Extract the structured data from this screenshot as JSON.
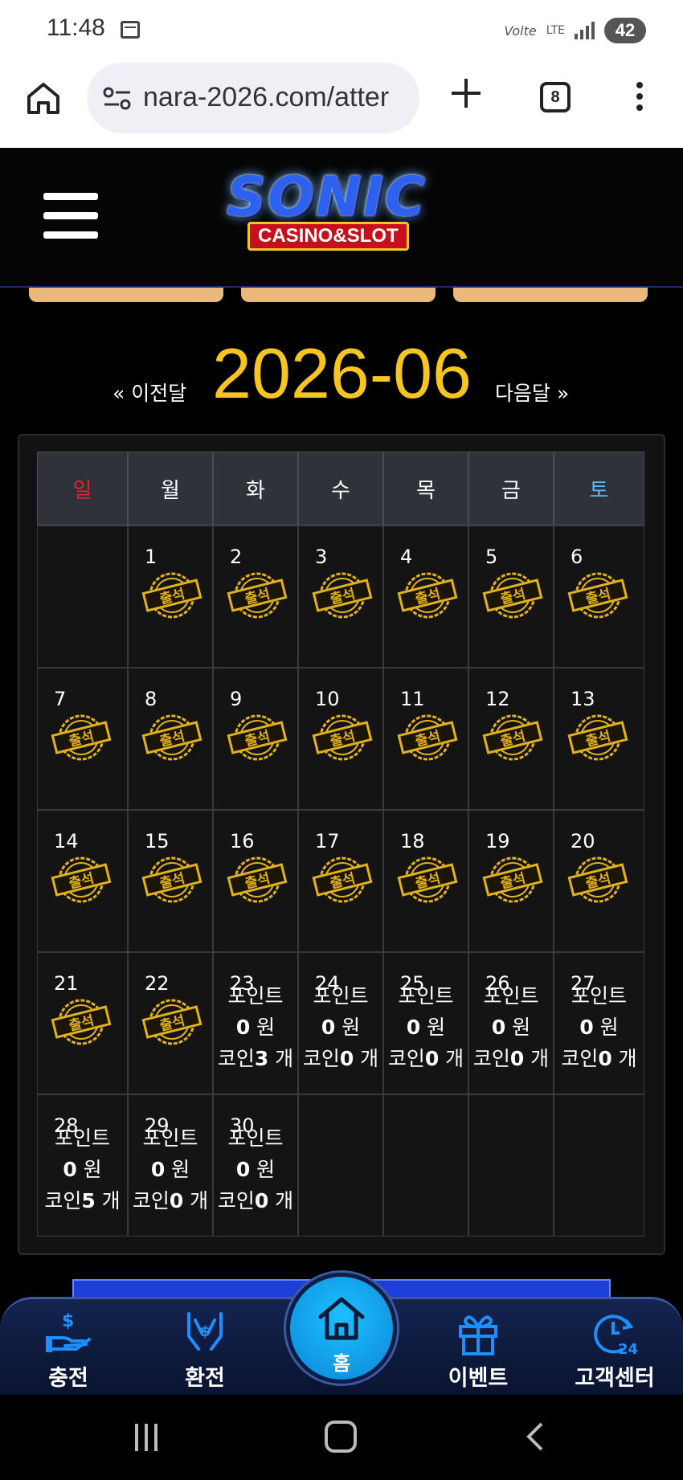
{
  "status_bar": {
    "time": "11:48",
    "volte": "Volte",
    "network": "LTE",
    "battery": "42"
  },
  "browser": {
    "url": "nara-2026.com/atter",
    "tab_count": "8"
  },
  "header": {
    "logo_title": "SONIC",
    "logo_subtitle": "CASINO&SLOT"
  },
  "calendar": {
    "prev_label": "« 이전달",
    "month": "2026-06",
    "next_label": "다음달 »",
    "weekdays": [
      "일",
      "월",
      "화",
      "수",
      "목",
      "금",
      "토"
    ],
    "weekday_colors": [
      "#e0242f",
      "#ffffff",
      "#ffffff",
      "#ffffff",
      "#ffffff",
      "#ffffff",
      "#5db8ff"
    ],
    "attendance_stamp_text": "출석",
    "points_label": "포인트",
    "won_unit": " 원",
    "coin_label": "코인",
    "count_unit": " 개",
    "weeks": [
      [
        null,
        {
          "day": "1",
          "stamp": true
        },
        {
          "day": "2",
          "stamp": true
        },
        {
          "day": "3",
          "stamp": true
        },
        {
          "day": "4",
          "stamp": true
        },
        {
          "day": "5",
          "stamp": true
        },
        {
          "day": "6",
          "stamp": true
        }
      ],
      [
        {
          "day": "7",
          "stamp": true
        },
        {
          "day": "8",
          "stamp": true
        },
        {
          "day": "9",
          "stamp": true
        },
        {
          "day": "10",
          "stamp": true
        },
        {
          "day": "11",
          "stamp": true
        },
        {
          "day": "12",
          "stamp": true
        },
        {
          "day": "13",
          "stamp": true
        }
      ],
      [
        {
          "day": "14",
          "stamp": true
        },
        {
          "day": "15",
          "stamp": true
        },
        {
          "day": "16",
          "stamp": true
        },
        {
          "day": "17",
          "stamp": true
        },
        {
          "day": "18",
          "stamp": true
        },
        {
          "day": "19",
          "stamp": true
        },
        {
          "day": "20",
          "stamp": true
        }
      ],
      [
        {
          "day": "21",
          "stamp": true
        },
        {
          "day": "22",
          "stamp": true
        },
        {
          "day": "23",
          "points": "0",
          "coins": "3"
        },
        {
          "day": "24",
          "points": "0",
          "coins": "0"
        },
        {
          "day": "25",
          "points": "0",
          "coins": "0"
        },
        {
          "day": "26",
          "points": "0",
          "coins": "0"
        },
        {
          "day": "27",
          "points": "0",
          "coins": "0"
        }
      ],
      [
        {
          "day": "28",
          "points": "0",
          "coins": "5"
        },
        {
          "day": "29",
          "points": "0",
          "coins": "0"
        },
        {
          "day": "30",
          "points": "0",
          "coins": "0"
        },
        null,
        null,
        null,
        null
      ]
    ]
  },
  "bottom_nav": {
    "items": [
      {
        "label": "충전",
        "icon": "deposit-icon"
      },
      {
        "label": "환전",
        "icon": "exchange-icon"
      },
      {
        "label": "이벤트",
        "icon": "gift-icon"
      },
      {
        "label": "고객센터",
        "icon": "support-24h-icon"
      }
    ],
    "home_label": "홈"
  },
  "colors": {
    "accent_yellow": "#f7c520",
    "nav_blue": "#1ec0ff",
    "stamp_gold": "#e3b21a"
  }
}
